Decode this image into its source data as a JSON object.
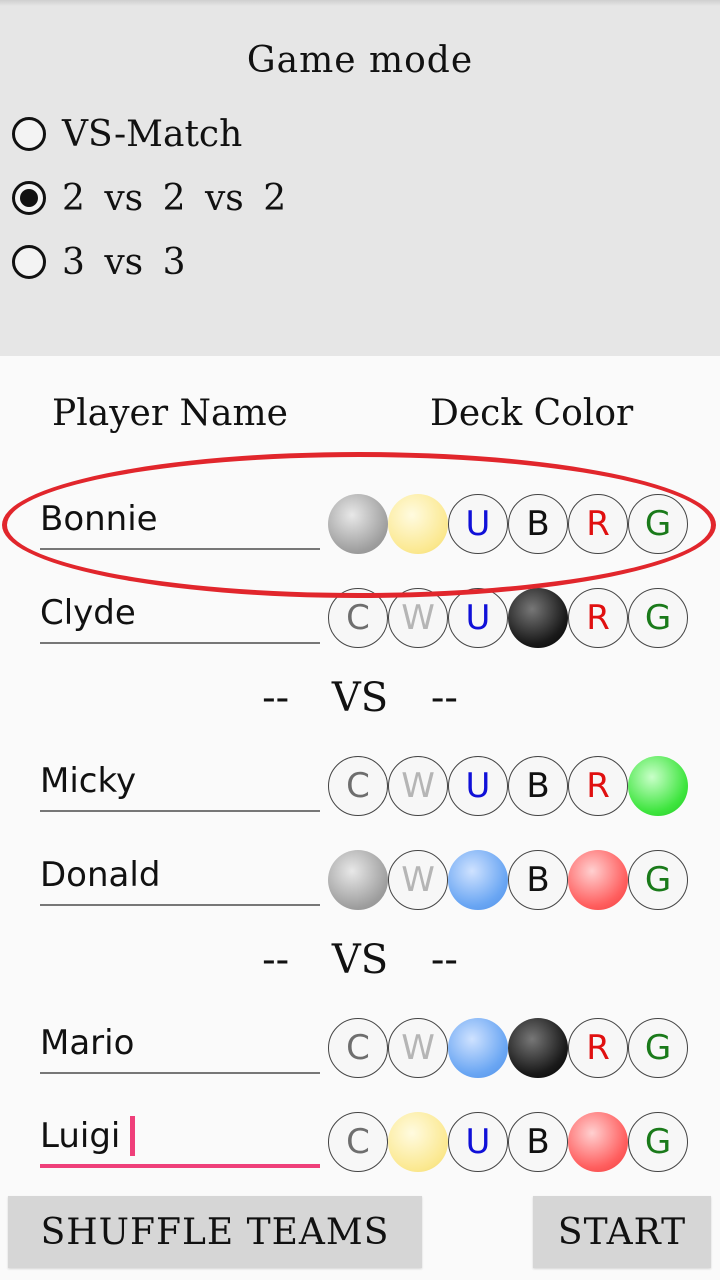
{
  "game_mode": {
    "title": "Game mode",
    "options": [
      {
        "label": "VS-Match",
        "selected": false
      },
      {
        "label": "2 vs 2 vs 2",
        "selected": true
      },
      {
        "label": "3 vs 3",
        "selected": false
      }
    ]
  },
  "table_header": {
    "player_name": "Player Name",
    "deck_color": "Deck Color"
  },
  "color_letters": [
    "C",
    "W",
    "U",
    "B",
    "R",
    "G"
  ],
  "letter_colors": {
    "C": "#6e6e6e",
    "W": "#b5b5b5",
    "U": "#1010d8",
    "B": "#111111",
    "R": "#e01010",
    "G": "#1a7a1a"
  },
  "players": [
    {
      "name": "Bonnie",
      "selected": [
        true,
        true,
        false,
        false,
        false,
        false
      ]
    },
    {
      "name": "Clyde",
      "selected": [
        false,
        false,
        false,
        true,
        false,
        false
      ]
    },
    {
      "name": "Micky",
      "selected": [
        false,
        false,
        false,
        false,
        false,
        true
      ]
    },
    {
      "name": "Donald",
      "selected": [
        true,
        false,
        true,
        false,
        true,
        false
      ]
    },
    {
      "name": "Mario",
      "selected": [
        false,
        false,
        true,
        true,
        false,
        false
      ]
    },
    {
      "name": "Luigi",
      "selected": [
        false,
        true,
        false,
        false,
        true,
        false
      ]
    }
  ],
  "vs_label": "-- VS --",
  "buttons": {
    "shuffle": "SHUFFLE TEAMS",
    "start": "START"
  }
}
